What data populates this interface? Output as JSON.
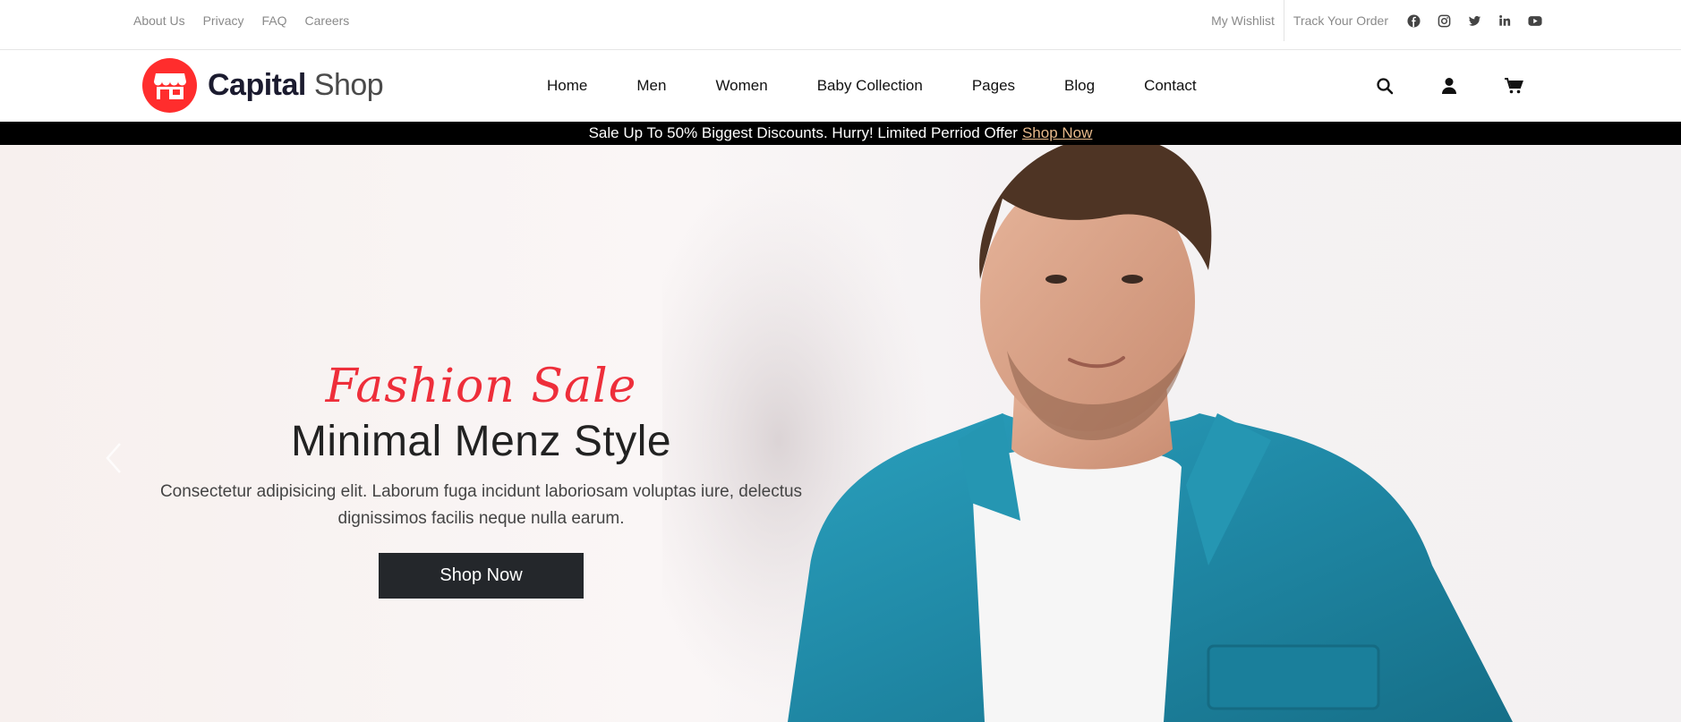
{
  "topbar": {
    "left_links": [
      "About Us",
      "Privacy",
      "FAQ",
      "Careers"
    ],
    "wishlist": "My Wishlist",
    "track_order": "Track Your Order",
    "socials": [
      "facebook-icon",
      "instagram-icon",
      "twitter-icon",
      "linkedin-icon",
      "youtube-icon"
    ]
  },
  "header": {
    "logo_bold": "Capital",
    "logo_light": "Shop",
    "nav": [
      "Home",
      "Men",
      "Women",
      "Baby Collection",
      "Pages",
      "Blog",
      "Contact"
    ],
    "icons": [
      "search-icon",
      "user-icon",
      "cart-icon"
    ]
  },
  "promo": {
    "text": "Sale Up To 50% Biggest Discounts. Hurry! Limited Perriod Offer",
    "link": "Shop Now"
  },
  "hero": {
    "script": "Fashion Sale",
    "title": "Minimal Menz Style",
    "description": "Consectetur adipisicing elit. Laborum fuga incidunt laboriosam voluptas iure, delectus dignissimos facilis neque nulla earum.",
    "button": "Shop Now"
  },
  "colors": {
    "accent_red": "#ff2d2d",
    "script_red": "#ee2e3a",
    "promo_link": "#e7b98b",
    "button_dark": "#24272b",
    "denim": "#2a90ad"
  }
}
